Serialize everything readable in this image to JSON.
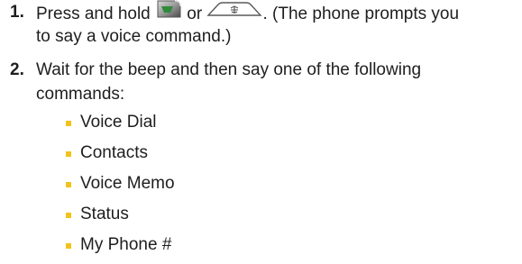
{
  "steps": [
    {
      "number": "1.",
      "lines": [
        {
          "before": "Press and hold ",
          "middle": " or ",
          "after": ". (The phone prompts you"
        },
        "to say a voice command.)"
      ]
    },
    {
      "number": "2.",
      "lines": [
        "Wait for the beep and then say one of the following",
        "commands:"
      ]
    }
  ],
  "commands": [
    "Voice Dial",
    "Contacts",
    "Voice Memo",
    "Status",
    "My Phone #"
  ],
  "icons": {
    "talk_key": "talk-key-icon",
    "side_key": "side-voice-key-icon"
  },
  "colors": {
    "text": "#1e1e1e",
    "bullet": "#f2c31a",
    "talk_key_green": "#2f8a3a",
    "key_gray": "#8a8a8a"
  }
}
